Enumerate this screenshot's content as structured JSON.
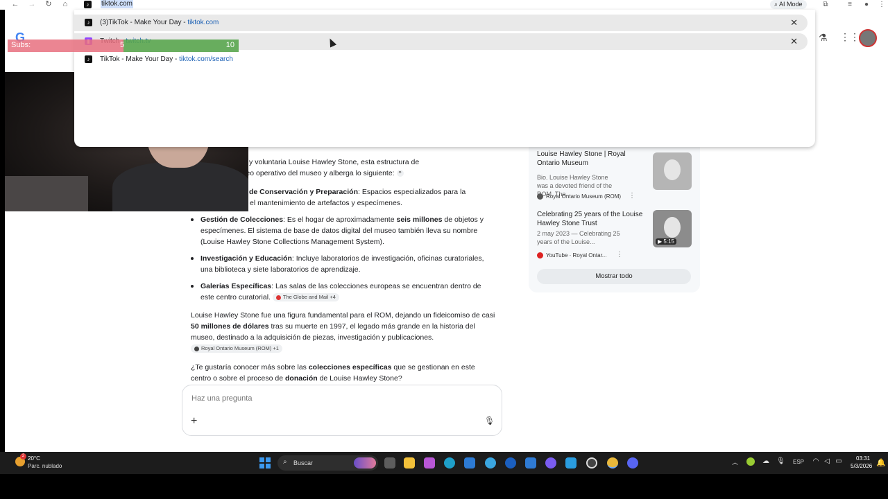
{
  "browser": {
    "omnibox_text": "tiktok.com",
    "ai_mode_label": "AI Mode",
    "suggestions": [
      {
        "title": "(3)TikTok - Make Your Day - ",
        "url": "tiktok.com",
        "removable": true
      },
      {
        "title": "Twitch - ",
        "url": "twitch.tv",
        "removable": true
      },
      {
        "title": "TikTok - Make Your Day - ",
        "url": "tiktok.com/search",
        "removable": false
      }
    ]
  },
  "overlay": {
    "subs_label": "Subs:",
    "subs_current": "5",
    "subs_goal": "10",
    "subs_progress": 0.5
  },
  "answer": {
    "p1_frag": "nor a la filántropa y voluntaria Louise Hawley Stone, esta estructura de",
    "p1_frag2": "ona como el núcleo operativo del museo y alberga lo siguiente:",
    "b1_bold": "de Conservación y Preparación",
    "b1_rest": ": Espacios especializados para la",
    "b1_line2": "el mantenimiento de artefactos y especímenes.",
    "b2_bold": "Gestión de Colecciones",
    "b2_a": ": Es el hogar de aproximadamente ",
    "b2_bold2": "seis millones",
    "b2_b": " de objetos y especímenes. El sistema de base de datos digital del museo también lleva su nombre (Louise Hawley Stone Collections Management System).",
    "b3_bold": "Investigación y Educación",
    "b3_rest": ": Incluye laboratorios de investigación, oficinas curatoriales, una biblioteca y siete laboratorios de aprendizaje.",
    "b4_bold": "Galerías Específicas",
    "b4_rest": ": Las salas de las colecciones europeas se encuentran dentro de este centro curatorial.",
    "b4_chip": "The Globe and Mail +4",
    "p2_a": "Louise Hawley Stone fue una figura fundamental para el ROM, dejando un fideicomiso de casi ",
    "p2_bold": "50 millones de dólares",
    "p2_b": " tras su muerte en 1997, el legado más grande en la historia del museo, destinado a la adquisición de piezas, investigación y publicaciones.",
    "p2_chip": "Royal Ontario Museum (ROM) +1",
    "p3_a": "¿Te gustaría conocer más sobre las ",
    "p3_bold": "colecciones específicas",
    "p3_b": " que se gestionan en este centro o sobre el proceso de ",
    "p3_bold2": "donación",
    "p3_c": " de Louise Hawley Stone?"
  },
  "ask": {
    "placeholder": "Haz una pregunta"
  },
  "side": {
    "card1_title": "Louise Hawley Stone | Royal Ontario Museum",
    "card1_desc": "Bio. Louise Hawley Stone was a devoted friend of the ROM. The...",
    "card1_src": "Royal Ontario Museum (ROM)",
    "card2_title": "Celebrating 25 years of the Louise Hawley Stone Trust",
    "card2_desc": "2 may 2023 — Celebrating 25 years of the Louise...",
    "card2_src": "YouTube · Royal Ontar...",
    "card2_duration": "5:15",
    "show_all": "Mostrar todo"
  },
  "taskbar": {
    "weather_temp": "20°C",
    "weather_desc": "Parc. nublado",
    "weather_badge": "2",
    "search_label": "Buscar",
    "lang": "ESP",
    "time": "03:31",
    "date": "5/3/2026"
  },
  "colors": {
    "subs_left": "#e8707f",
    "subs_right": "#5aa64f",
    "taskbar": "#1c1c1c",
    "link": "#1a5fb4"
  }
}
